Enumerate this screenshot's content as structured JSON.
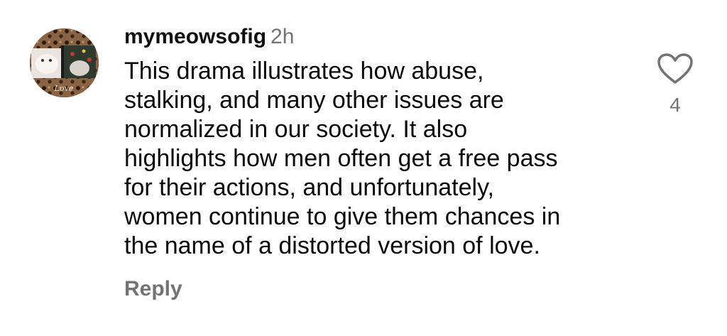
{
  "comment": {
    "username": "mymeowsofig",
    "timestamp": "2h",
    "text_lines": [
      "This drama illustrates how abuse,",
      "stalking, and many other issues are",
      "normalized in our society. It also",
      "highlights how men often get a free pass",
      "for their actions, and unfortunately,",
      "women continue to give them chances in",
      "the name of a distorted version of love."
    ],
    "reply_label": "Reply",
    "like_count": "4",
    "like_icon": "heart-outline-icon",
    "avatar_caption": "Love",
    "colors": {
      "secondary_text": "#737373",
      "primary_text": "#0a0a0a"
    }
  }
}
